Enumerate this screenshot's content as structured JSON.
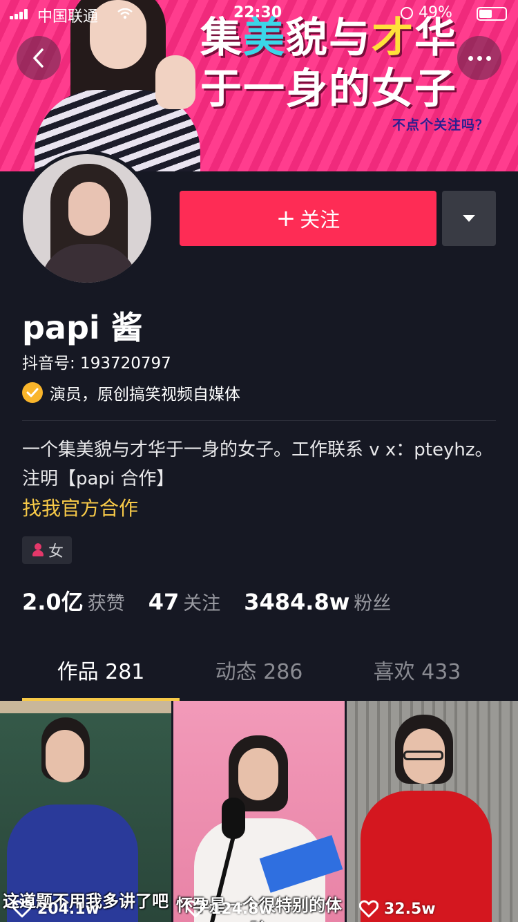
{
  "status_bar": {
    "carrier": "中国联通",
    "time": "22:30",
    "battery": "49%",
    "battery_level": 0.49
  },
  "banner": {
    "line1": "集美貌与才华",
    "line2": "于一身的女子",
    "subtitle": "不点个关注吗？",
    "accent_colors": {
      "mei": "#3ad6e8",
      "cai": "#ffe13a"
    }
  },
  "nav": {
    "back_icon": "chevron-left-icon",
    "more_icon": "more-dots-icon"
  },
  "profile": {
    "follow_label": "关注",
    "name": "papi 酱",
    "douyin_id": "抖音号: 193720797",
    "verified_text": "演员，原创搞笑视频自媒体",
    "bio": "一个集美貌与才华于一身的女子。工作联系 v x：pteyhz。注明【papi 合作】",
    "bio_link": "找我官方合作",
    "gender": "女"
  },
  "stats": [
    {
      "value": "2.0亿",
      "label": "获赞"
    },
    {
      "value": "47",
      "label": "关注"
    },
    {
      "value": "3484.8w",
      "label": "粉丝"
    }
  ],
  "tabs": [
    {
      "label": "作品 281",
      "active": true
    },
    {
      "label": "动态 286",
      "active": false
    },
    {
      "label": "喜欢 433",
      "active": false
    }
  ],
  "videos": [
    {
      "likes": "204.1w",
      "caption": "这道题不用我多讲了吧"
    },
    {
      "likes": "124.8w",
      "caption": "怀孕是一个很特别的体验"
    },
    {
      "likes": "32.5w",
      "caption": ""
    }
  ],
  "colors": {
    "accent": "#fe2c55",
    "highlight": "#f7c948",
    "background": "#161823"
  }
}
